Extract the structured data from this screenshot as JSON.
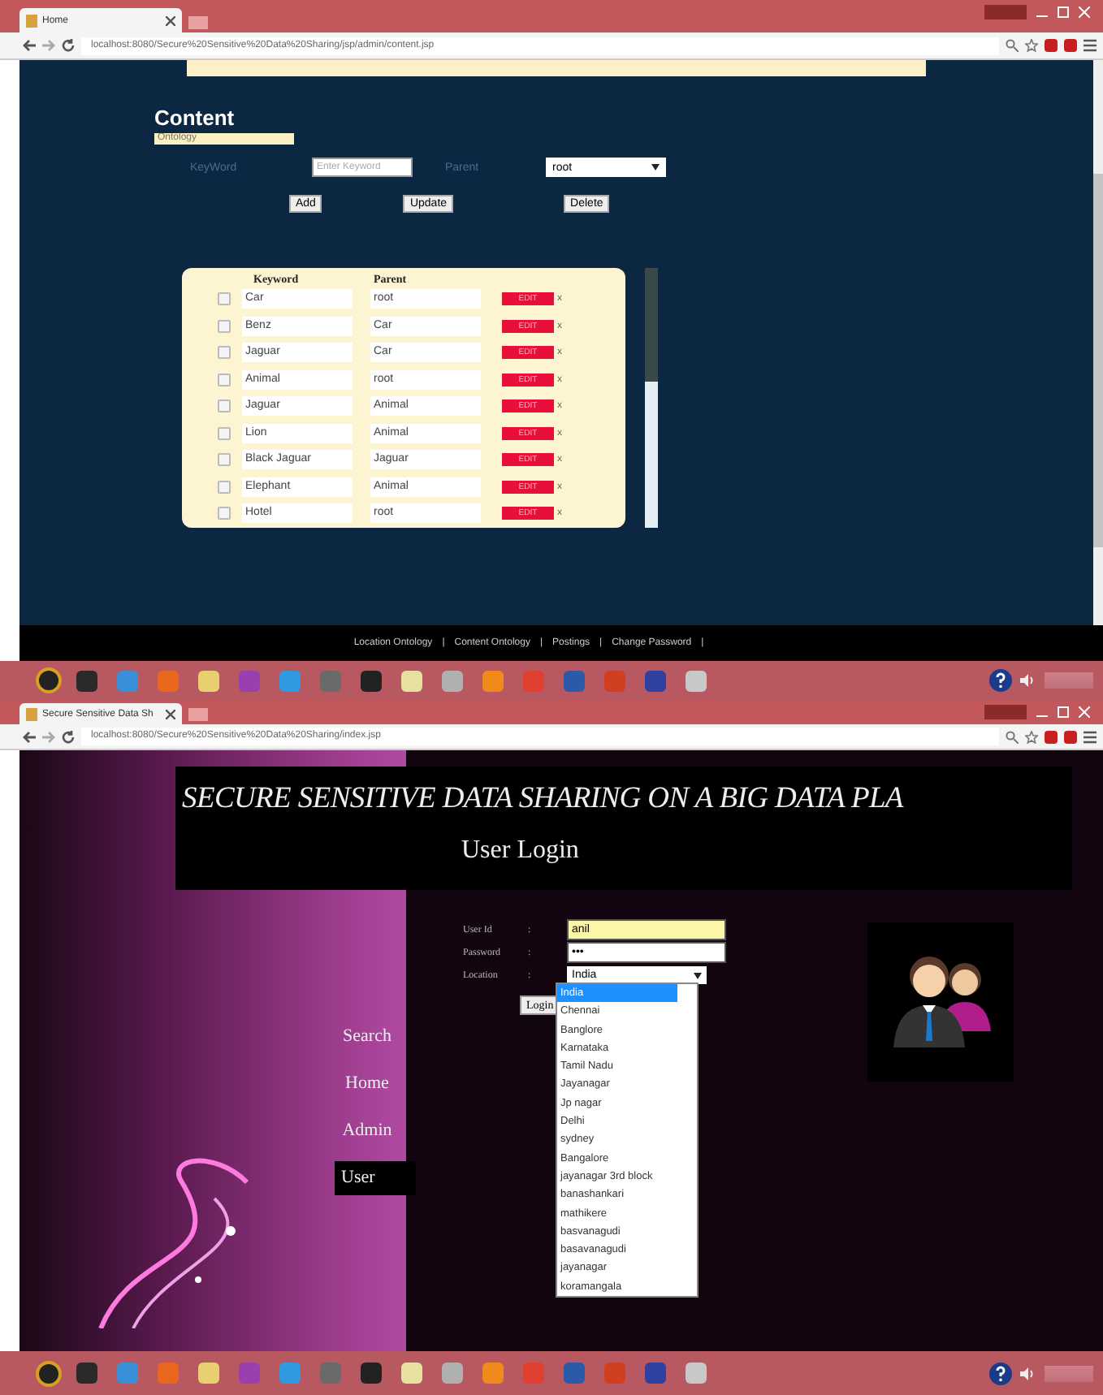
{
  "windows": [
    {
      "tab": {
        "title": "Home"
      },
      "address": "localhost:8080/Secure%20Sensitive%20Data%20Sharing/jsp/admin/content.jsp",
      "content": {
        "heading": "Content",
        "badge": "Ontology",
        "keyword": {
          "label": "KeyWord",
          "placeholder": "Enter Keyword"
        },
        "parent": {
          "label": "Parent",
          "value": "root"
        },
        "buttons": [
          "Add",
          "Update",
          "Delete"
        ],
        "table": {
          "columns": [
            "Keyword",
            "Parent"
          ],
          "rows": [
            {
              "keyword": "Car",
              "parent": "root",
              "action": "EDIT",
              "remove": "x",
              "checked": false
            },
            {
              "keyword": "Benz",
              "parent": "Car",
              "action": "EDIT",
              "remove": "x",
              "checked": false
            },
            {
              "keyword": "Jaguar",
              "parent": "Car",
              "action": "EDIT",
              "remove": "x",
              "checked": false
            },
            {
              "keyword": "Animal",
              "parent": "root",
              "action": "EDIT",
              "remove": "x",
              "checked": false
            },
            {
              "keyword": "Jaguar",
              "parent": "Animal",
              "action": "EDIT",
              "remove": "x",
              "checked": false
            },
            {
              "keyword": "Lion",
              "parent": "Animal",
              "action": "EDIT",
              "remove": "x",
              "checked": false
            },
            {
              "keyword": "Black Jaguar",
              "parent": "Jaguar",
              "action": "EDIT",
              "remove": "x",
              "checked": false
            },
            {
              "keyword": "Elephant",
              "parent": "Animal",
              "action": "EDIT",
              "remove": "x",
              "checked": false
            },
            {
              "keyword": "Hotel",
              "parent": "root",
              "action": "EDIT",
              "remove": "x",
              "checked": false
            }
          ]
        },
        "footer_links": [
          "Location Ontology",
          "Content Ontology",
          "Postings",
          "Change Password"
        ],
        "separator": "|"
      }
    },
    {
      "tab": {
        "title": "Secure Sensitive Data Sh"
      },
      "address": "localhost:8080/Secure%20Sensitive%20Data%20Sharing/index.jsp",
      "login": {
        "site_title": "SECURE SENSITIVE DATA SHARING ON A BIG DATA PLA",
        "heading": "User Login",
        "nav": [
          {
            "label": "Search",
            "selected": false
          },
          {
            "label": "Home",
            "selected": false
          },
          {
            "label": "Admin",
            "selected": false
          },
          {
            "label": "User",
            "selected": true
          }
        ],
        "fields": [
          {
            "label": "User Id",
            "colon": ":",
            "value": "anil",
            "kind": "text"
          },
          {
            "label": "Password",
            "colon": ":",
            "value": "•••",
            "kind": "password"
          },
          {
            "label": "Location",
            "colon": ":",
            "value": "India",
            "kind": "select"
          }
        ],
        "login_button": "Login",
        "dropdown": [
          {
            "label": "India",
            "selected": true
          },
          {
            "label": "Chennai",
            "selected": false
          },
          {
            "label": "Banglore",
            "selected": false
          },
          {
            "label": "Karnataka",
            "selected": false
          },
          {
            "label": "Tamil Nadu",
            "selected": false
          },
          {
            "label": "Jayanagar",
            "selected": false
          },
          {
            "label": "Jp nagar",
            "selected": false
          },
          {
            "label": "Delhi",
            "selected": false
          },
          {
            "label": "sydney",
            "selected": false
          },
          {
            "label": "Bangalore",
            "selected": false
          },
          {
            "label": "jayanagar 3rd block",
            "selected": false
          },
          {
            "label": "banashankari",
            "selected": false
          },
          {
            "label": "mathikere",
            "selected": false
          },
          {
            "label": "basvanagudi",
            "selected": false
          },
          {
            "label": "basavanagudi",
            "selected": false
          },
          {
            "label": "jayanagar",
            "selected": false
          },
          {
            "label": "koramangala",
            "selected": false
          }
        ]
      }
    }
  ]
}
